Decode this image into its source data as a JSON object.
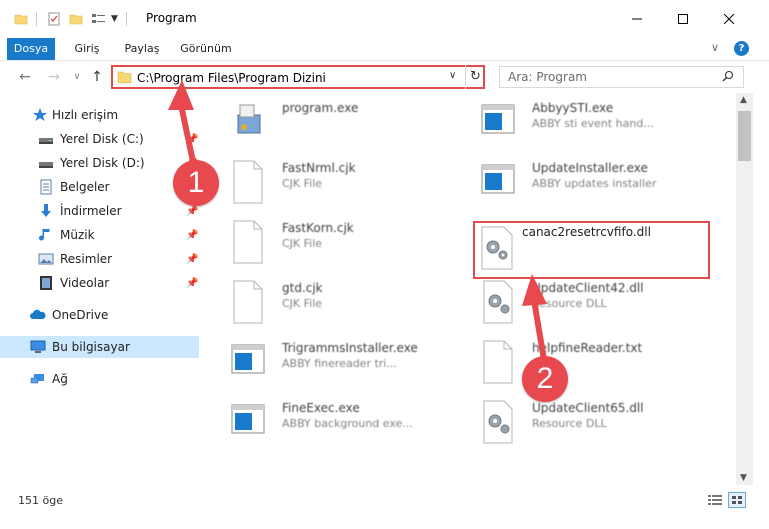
{
  "window": {
    "title": "Program"
  },
  "ribbon": {
    "tabs": [
      "Dosya",
      "Giriş",
      "Paylaş",
      "Görünüm"
    ],
    "active_tab": "Dosya"
  },
  "address": {
    "path": "C:\\Program Files\\Program Dizini",
    "search_placeholder": "Ara: Program"
  },
  "sidebar": {
    "items": [
      {
        "label": "Hızlı erişim",
        "icon": "star-icon"
      },
      {
        "label": "Yerel Disk (C:)",
        "icon": "drive-icon",
        "pinned": true
      },
      {
        "label": "Yerel Disk (D:)",
        "icon": "drive-icon",
        "pinned": true
      },
      {
        "label": "Belgeler",
        "icon": "documents-icon",
        "pinned": true
      },
      {
        "label": "İndirmeler",
        "icon": "download-icon",
        "pinned": true
      },
      {
        "label": "Müzik",
        "icon": "music-icon",
        "pinned": true
      },
      {
        "label": "Resimler",
        "icon": "pictures-icon",
        "pinned": true
      },
      {
        "label": "Videolar",
        "icon": "videos-icon",
        "pinned": true
      },
      {
        "label": "OneDrive",
        "icon": "cloud-icon"
      },
      {
        "label": "Bu bilgisayar",
        "icon": "computer-icon",
        "selected": true
      },
      {
        "label": "Ağ",
        "icon": "network-icon"
      }
    ]
  },
  "files": [
    {
      "name": "program.exe",
      "desc": "",
      "icon": "installer-icon"
    },
    {
      "name": "AbbyySTI.exe",
      "desc": "ABBY sti event hand...",
      "icon": "app-window-icon"
    },
    {
      "name": "FastNrml.cjk",
      "desc": "CJK File",
      "icon": "blank-file-icon"
    },
    {
      "name": "UpdateInstaller.exe",
      "desc": "ABBY updates installer",
      "icon": "app-window-icon"
    },
    {
      "name": "FastKorn.cjk",
      "desc": "CJK File",
      "icon": "blank-file-icon"
    },
    {
      "name": "canac2resetrcvfifo.dll",
      "desc": "",
      "icon": "dll-gear-icon",
      "highlighted": true
    },
    {
      "name": "gtd.cjk",
      "desc": "CJK File",
      "icon": "blank-file-icon"
    },
    {
      "name": "UpdateClient42.dll",
      "desc": "Resource DLL",
      "icon": "dll-gear-icon"
    },
    {
      "name": "TrigrammsInstaller.exe",
      "desc": "ABBY finereader tri...",
      "icon": "app-window-icon"
    },
    {
      "name": "helpfineReader.txt",
      "desc": "",
      "icon": "blank-file-icon"
    },
    {
      "name": "FineExec.exe",
      "desc": "ABBY background exe...",
      "icon": "app-window-icon"
    },
    {
      "name": "UpdateClient65.dll",
      "desc": "Resource DLL",
      "icon": "dll-gear-icon"
    }
  ],
  "status": {
    "item_count": "151 öge"
  },
  "annotations": [
    {
      "label": "1"
    },
    {
      "label": "2"
    }
  ],
  "colors": {
    "accent": "#1979ca",
    "highlight": "#e04b4b",
    "selection": "#cce8ff"
  }
}
